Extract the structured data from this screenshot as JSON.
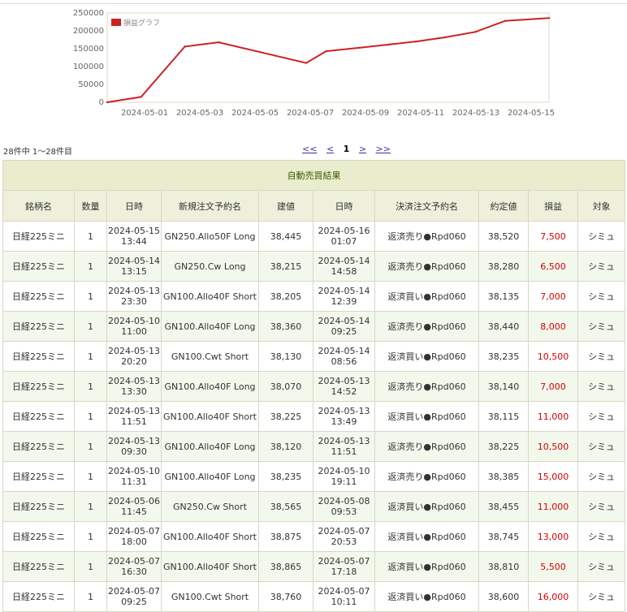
{
  "chart_data": {
    "type": "line",
    "legend": "損益グラフ",
    "x": [
      "2024-04-30",
      "2024-05-01",
      "2024-05-02",
      "2024-05-03",
      "2024-05-05",
      "2024-05-06",
      "2024-05-07",
      "2024-05-09",
      "2024-05-10",
      "2024-05-12",
      "2024-05-13",
      "2024-05-13b",
      "2024-05-15"
    ],
    "x_ticks": [
      "2024-05-01",
      "2024-05-03",
      "2024-05-05",
      "2024-05-07",
      "2024-05-09",
      "2024-05-11",
      "2024-05-13",
      "2024-05-15"
    ],
    "y_ticks": [
      "0",
      "50000",
      "100000",
      "150000",
      "200000",
      "250000"
    ],
    "ylim": [
      0,
      250000
    ],
    "grid": false,
    "legend_position": "top-left",
    "color": "#cc2222"
  },
  "summary": {
    "count_text": "28件中 1～28件目",
    "pager_first": "<<",
    "pager_prev": "<",
    "pager_current": "1",
    "pager_next": ">",
    "pager_last": ">>"
  },
  "table": {
    "caption": "自動売買結果",
    "headers": [
      "銘柄名",
      "数量",
      "日時",
      "新規注文予約名",
      "建値",
      "日時",
      "決済注文予約名",
      "約定値",
      "損益",
      "対象"
    ],
    "rows": [
      {
        "name": "日経225ミニ",
        "qty": "1",
        "open_date": "2024-05-15",
        "open_time": "13:44",
        "entry": "GN250.Allo50F Long",
        "open_price": "38,445",
        "close_date": "2024-05-16",
        "close_time": "01:07",
        "exit": "返済売り●Rpd060",
        "close_price": "38,520",
        "pl": "7,500",
        "target": "シミュ"
      },
      {
        "name": "日経225ミニ",
        "qty": "1",
        "open_date": "2024-05-14",
        "open_time": "13:15",
        "entry": "GN250.Cw Long",
        "open_price": "38,215",
        "close_date": "2024-05-14",
        "close_time": "14:58",
        "exit": "返済売り●Rpd060",
        "close_price": "38,280",
        "pl": "6,500",
        "target": "シミュ"
      },
      {
        "name": "日経225ミニ",
        "qty": "1",
        "open_date": "2024-05-13",
        "open_time": "23:30",
        "entry": "GN100.Allo40F Short",
        "open_price": "38,205",
        "close_date": "2024-05-14",
        "close_time": "12:39",
        "exit": "返済買い●Rpd060",
        "close_price": "38,135",
        "pl": "7,000",
        "target": "シミュ"
      },
      {
        "name": "日経225ミニ",
        "qty": "1",
        "open_date": "2024-05-10",
        "open_time": "11:00",
        "entry": "GN100.Allo40F Long",
        "open_price": "38,360",
        "close_date": "2024-05-14",
        "close_time": "09:25",
        "exit": "返済売り●Rpd060",
        "close_price": "38,440",
        "pl": "8,000",
        "target": "シミュ"
      },
      {
        "name": "日経225ミニ",
        "qty": "1",
        "open_date": "2024-05-13",
        "open_time": "20:20",
        "entry": "GN100.Cwt Short",
        "open_price": "38,130",
        "close_date": "2024-05-14",
        "close_time": "08:56",
        "exit": "返済買い●Rpd060",
        "close_price": "38,235",
        "pl": "10,500",
        "target": "シミュ"
      },
      {
        "name": "日経225ミニ",
        "qty": "1",
        "open_date": "2024-05-13",
        "open_time": "13:30",
        "entry": "GN100.Allo40F Long",
        "open_price": "38,070",
        "close_date": "2024-05-13",
        "close_time": "14:52",
        "exit": "返済売り●Rpd060",
        "close_price": "38,140",
        "pl": "7,000",
        "target": "シミュ"
      },
      {
        "name": "日経225ミニ",
        "qty": "1",
        "open_date": "2024-05-13",
        "open_time": "11:51",
        "entry": "GN100.Allo40F Short",
        "open_price": "38,225",
        "close_date": "2024-05-13",
        "close_time": "13:49",
        "exit": "返済買い●Rpd060",
        "close_price": "38,115",
        "pl": "11,000",
        "target": "シミュ"
      },
      {
        "name": "日経225ミニ",
        "qty": "1",
        "open_date": "2024-05-13",
        "open_time": "09:30",
        "entry": "GN100.Allo40F Long",
        "open_price": "38,120",
        "close_date": "2024-05-13",
        "close_time": "11:51",
        "exit": "返済売り●Rpd060",
        "close_price": "38,225",
        "pl": "10,500",
        "target": "シミュ"
      },
      {
        "name": "日経225ミニ",
        "qty": "1",
        "open_date": "2024-05-10",
        "open_time": "11:31",
        "entry": "GN100.Allo40F Long",
        "open_price": "38,235",
        "close_date": "2024-05-10",
        "close_time": "19:11",
        "exit": "返済売り●Rpd060",
        "close_price": "38,385",
        "pl": "15,000",
        "target": "シミュ"
      },
      {
        "name": "日経225ミニ",
        "qty": "1",
        "open_date": "2024-05-06",
        "open_time": "11:45",
        "entry": "GN250.Cw Short",
        "open_price": "38,565",
        "close_date": "2024-05-08",
        "close_time": "09:53",
        "exit": "返済買い●Rpd060",
        "close_price": "38,455",
        "pl": "11,000",
        "target": "シミュ"
      },
      {
        "name": "日経225ミニ",
        "qty": "1",
        "open_date": "2024-05-07",
        "open_time": "18:00",
        "entry": "GN100.Allo40F Short",
        "open_price": "38,875",
        "close_date": "2024-05-07",
        "close_time": "20:53",
        "exit": "返済買い●Rpd060",
        "close_price": "38,745",
        "pl": "13,000",
        "target": "シミュ"
      },
      {
        "name": "日経225ミニ",
        "qty": "1",
        "open_date": "2024-05-07",
        "open_time": "16:30",
        "entry": "GN100.Allo40F Short",
        "open_price": "38,865",
        "close_date": "2024-05-07",
        "close_time": "17:18",
        "exit": "返済買い●Rpd060",
        "close_price": "38,810",
        "pl": "5,500",
        "target": "シミュ"
      },
      {
        "name": "日経225ミニ",
        "qty": "1",
        "open_date": "2024-05-07",
        "open_time": "09:25",
        "entry": "GN100.Cwt Short",
        "open_price": "38,760",
        "close_date": "2024-05-07",
        "close_time": "10:11",
        "exit": "返済買い●Rpd060",
        "close_price": "38,600",
        "pl": "16,000",
        "target": "シミュ"
      }
    ]
  }
}
